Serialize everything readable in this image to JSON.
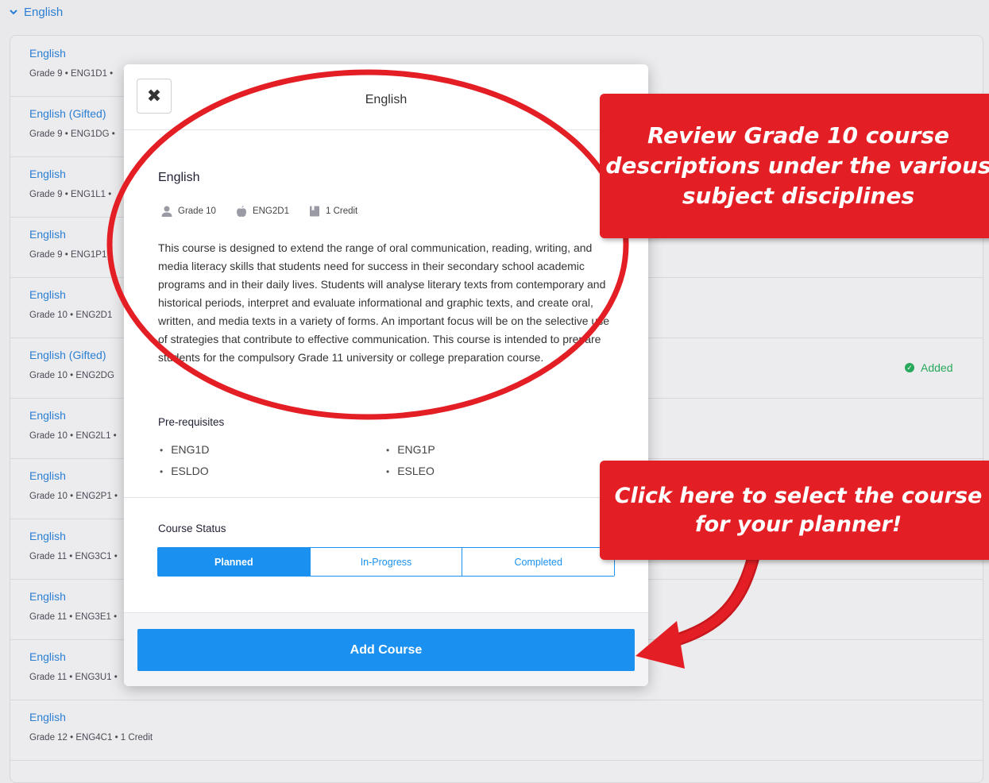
{
  "section": {
    "label": "English"
  },
  "courses": [
    {
      "name": "English",
      "meta": "Grade 9 • ENG1D1 •"
    },
    {
      "name": "English (Gifted)",
      "meta": "Grade 9 • ENG1DG •"
    },
    {
      "name": "English",
      "meta": "Grade 9 • ENG1L1 •"
    },
    {
      "name": "English",
      "meta": "Grade 9 • ENG1P1 •"
    },
    {
      "name": "English",
      "meta": "Grade 10 • ENG2D1"
    },
    {
      "name": "English (Gifted)",
      "meta": "Grade 10 • ENG2DG",
      "status": "Added"
    },
    {
      "name": "English",
      "meta": "Grade 10 • ENG2L1 •"
    },
    {
      "name": "English",
      "meta": "Grade 10 • ENG2P1 •"
    },
    {
      "name": "English",
      "meta": "Grade 11 • ENG3C1 •"
    },
    {
      "name": "English",
      "meta": "Grade 11 • ENG3E1 •"
    },
    {
      "name": "English",
      "meta": "Grade 11 • ENG3U1 •"
    },
    {
      "name": "English",
      "meta": "Grade 12 • ENG4C1 • 1 Credit"
    }
  ],
  "modal": {
    "title": "English",
    "close_icon": "close-icon",
    "course_title": "English",
    "grade": "Grade 10",
    "code": "ENG2D1",
    "credit": "1 Credit",
    "description": "This course is designed to extend the range of oral communication, reading, writing, and media literacy skills that students need for success in their secondary school academic programs and in their daily lives. Students will analyse literary texts from contemporary and historical periods, interpret and evaluate informational and graphic texts, and create oral, written, and media texts in a variety of forms. An important focus will be on the selective use of strategies that contribute to effective communication. This course is intended to prepare students for the compulsory Grade 11 university or college preparation course.",
    "prereq_title": "Pre-requisites",
    "prereqs": [
      "ENG1D",
      "ENG1P",
      "ESLDO",
      "ESLEO"
    ],
    "status_title": "Course Status",
    "status_options": [
      "Planned",
      "In-Progress",
      "Completed"
    ],
    "selected_status": "Planned",
    "add_button": "Add Course"
  },
  "annotations": {
    "callout_1": "Review Grade 10 course descriptions under the various subject disciplines",
    "callout_1_lines": [
      "Review Grade 10 course",
      "descriptions under the various",
      "subject disciplines"
    ],
    "callout_2_lines": [
      "Click here to select the course",
      "for your planner!"
    ],
    "accent_color": "#e31e24"
  },
  "colors": {
    "primary": "#1a91f0",
    "link": "#2a7fd4",
    "success": "#27a85a"
  }
}
